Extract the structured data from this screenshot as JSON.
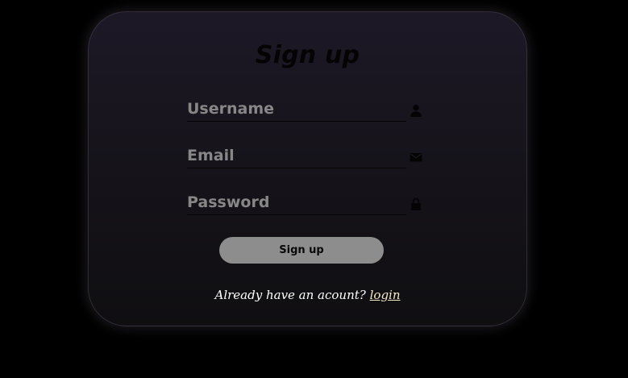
{
  "form": {
    "title": "Sign up",
    "fields": [
      {
        "placeholder": "Username",
        "value": "",
        "icon": "user-icon"
      },
      {
        "placeholder": "Email",
        "value": "",
        "icon": "envelope-icon"
      },
      {
        "placeholder": "Password",
        "value": "",
        "icon": "lock-icon"
      }
    ],
    "submit_label": "Sign up",
    "footer": {
      "prompt": "Already have an acount?",
      "link_label": "login"
    }
  },
  "colors": {
    "page_background": "#000000",
    "card_top": "#1d1826",
    "card_bottom": "#0f0e11",
    "button_background": "#8d8d8d",
    "placeholder_text": "#878787",
    "link_text": "#f3e9c6"
  }
}
